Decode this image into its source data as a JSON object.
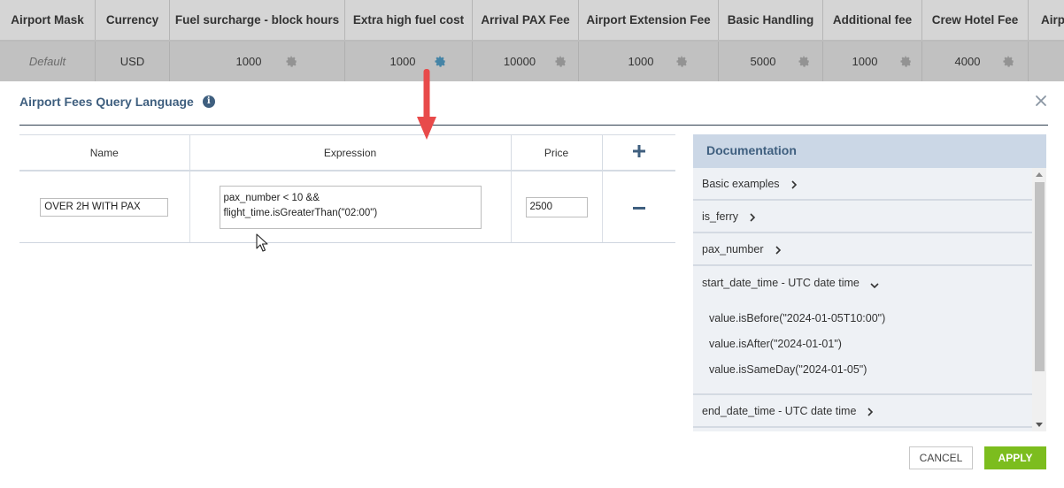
{
  "fees_table": {
    "columns": [
      "Airport Mask",
      "Currency",
      "Fuel surcharge - block hours",
      "Extra high fuel cost",
      "Arrival PAX Fee",
      "Airport Extension Fee",
      "Basic Handling",
      "Additional fee",
      "Crew Hotel Fee",
      "Airp"
    ],
    "row": [
      "Default",
      "USD",
      "1000",
      "1000",
      "10000",
      "1000",
      "5000",
      "1000",
      "4000",
      ""
    ]
  },
  "modal": {
    "title": "Airport Fees Query Language",
    "info_glyph": "i",
    "rules_table": {
      "headers": {
        "name": "Name",
        "expression": "Expression",
        "price": "Price"
      },
      "rows": [
        {
          "name": "OVER 2H WITH PAX",
          "expression": "pax_number < 10 &&\nflight_time.isGreaterThan(\"02:00\")",
          "price": "2500"
        }
      ]
    },
    "documentation": {
      "title": "Documentation",
      "items": [
        {
          "label": "Basic examples",
          "expanded": false
        },
        {
          "label": "is_ferry",
          "expanded": false
        },
        {
          "label": "pax_number",
          "expanded": false
        },
        {
          "label": "start_date_time - UTC date time",
          "expanded": true,
          "examples": [
            "value.isBefore(\"2024-01-05T10:00\")",
            "value.isAfter(\"2024-01-01\")",
            "value.isSameDay(\"2024-01-05\")"
          ]
        },
        {
          "label": "end_date_time - UTC date time",
          "expanded": false
        }
      ]
    },
    "buttons": {
      "cancel": "CANCEL",
      "apply": "APPLY"
    }
  },
  "colors": {
    "accent": "#3f5f7f",
    "apply": "#7cbd1e",
    "arrow": "#e84a4a",
    "gear": "#5aa0c0"
  }
}
